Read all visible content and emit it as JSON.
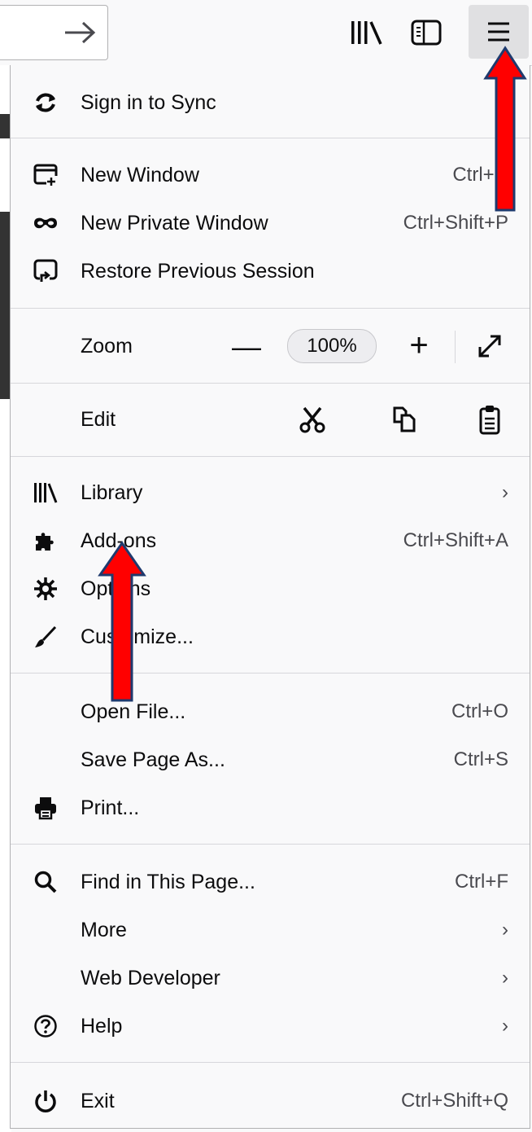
{
  "toolbar": {
    "go_icon": "arrow-right-icon",
    "library_icon": "library-icon",
    "sidebar_icon": "sidebars-icon",
    "menu_icon": "hamburger-menu-icon"
  },
  "menu": {
    "sync": {
      "label": "Sign in to Sync",
      "icon": "sync-icon"
    },
    "new_window": {
      "label": "New Window",
      "shortcut": "Ctrl+N",
      "icon": "new-window-icon"
    },
    "new_private": {
      "label": "New Private Window",
      "shortcut": "Ctrl+Shift+P",
      "icon": "private-mask-icon"
    },
    "restore": {
      "label": "Restore Previous Session",
      "icon": "restore-session-icon"
    },
    "zoom": {
      "label": "Zoom",
      "minus": "—",
      "value": "100%",
      "plus": "+",
      "fullscreen_icon": "fullscreen-icon"
    },
    "edit": {
      "label": "Edit",
      "cut_icon": "cut-icon",
      "copy_icon": "copy-icon",
      "paste_icon": "paste-icon"
    },
    "library": {
      "label": "Library",
      "chevron": "›",
      "icon": "library-icon"
    },
    "addons": {
      "label": "Add-ons",
      "shortcut": "Ctrl+Shift+A",
      "icon": "puzzle-icon"
    },
    "options": {
      "label": "Options",
      "icon": "gear-icon"
    },
    "customize": {
      "label": "Customize...",
      "icon": "paintbrush-icon"
    },
    "open_file": {
      "label": "Open File...",
      "shortcut": "Ctrl+O"
    },
    "save_page": {
      "label": "Save Page As...",
      "shortcut": "Ctrl+S"
    },
    "print": {
      "label": "Print...",
      "icon": "printer-icon"
    },
    "find": {
      "label": "Find in This Page...",
      "shortcut": "Ctrl+F",
      "icon": "search-icon"
    },
    "more": {
      "label": "More",
      "chevron": "›"
    },
    "web_dev": {
      "label": "Web Developer",
      "chevron": "›"
    },
    "help": {
      "label": "Help",
      "chevron": "›",
      "icon": "help-icon"
    },
    "exit": {
      "label": "Exit",
      "shortcut": "Ctrl+Shift+Q",
      "icon": "power-icon"
    }
  },
  "annotations": {
    "arrow_color": "#ff0000",
    "arrow_outline": "#1f3a6e"
  }
}
